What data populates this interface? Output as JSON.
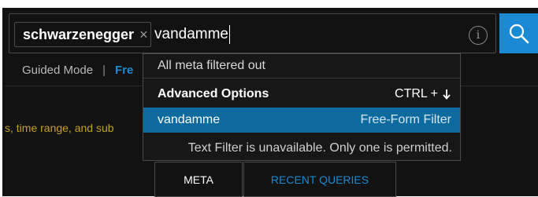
{
  "search": {
    "token_label": "schwarzenegger",
    "token_remove": "×",
    "query_value": "vandamme",
    "info_glyph": "i",
    "search_icon": "search-icon"
  },
  "modes": {
    "guided_label": "Guided Mode",
    "separator": "|",
    "free_label": "Fre"
  },
  "hint_text": "s, time range, and sub",
  "dropdown": {
    "status": "All meta filtered out",
    "advanced_label": "Advanced Options",
    "advanced_shortcut": "CTRL +",
    "suggestion_value": "vandamme",
    "suggestion_type": "Free-Form Filter",
    "warning": "Text Filter is unavailable. Only one is permitted."
  },
  "tabs": {
    "meta": "META",
    "recent": "RECENT QUERIES"
  },
  "colors": {
    "accent": "#1a8ad4",
    "highlight_row": "#0c6a9e",
    "background": "#121212",
    "hint": "#c6a12a"
  }
}
